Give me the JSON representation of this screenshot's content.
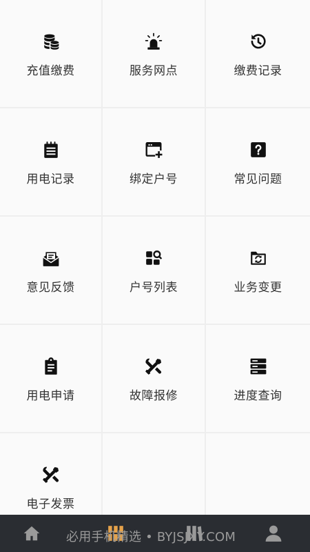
{
  "menu": {
    "items": [
      {
        "label": "充值缴费",
        "icon": "coins-icon"
      },
      {
        "label": "服务网点",
        "icon": "alarm-light-icon"
      },
      {
        "label": "缴费记录",
        "icon": "history-icon"
      },
      {
        "label": "用电记录",
        "icon": "notepad-icon"
      },
      {
        "label": "绑定户号",
        "icon": "window-add-icon"
      },
      {
        "label": "常见问题",
        "icon": "question-box-icon"
      },
      {
        "label": "意见反馈",
        "icon": "mail-open-icon"
      },
      {
        "label": "户号列表",
        "icon": "apps-search-icon"
      },
      {
        "label": "业务变更",
        "icon": "folder-sync-icon"
      },
      {
        "label": "用电申请",
        "icon": "clipboard-icon"
      },
      {
        "label": "故障报修",
        "icon": "tools-icon"
      },
      {
        "label": "进度查询",
        "icon": "server-icon"
      },
      {
        "label": "电子发票",
        "icon": "tools-icon"
      }
    ]
  },
  "tabbar": {
    "tabs": [
      {
        "name": "home",
        "icon": "home-icon"
      },
      {
        "name": "services",
        "icon": "grid-icon"
      },
      {
        "name": "library",
        "icon": "library-icon"
      },
      {
        "name": "profile",
        "icon": "person-icon"
      }
    ],
    "watermark": "必用手机精选 • BYJSJXY.COM"
  },
  "colors": {
    "tile_bg": "#fafafa",
    "divider": "#eeeeee",
    "label": "#333333",
    "icon": "#111111",
    "tabbar_bg": "#2a2d32",
    "tab_inactive": "#9a9a9a",
    "tab_active": "#e5a24a"
  }
}
